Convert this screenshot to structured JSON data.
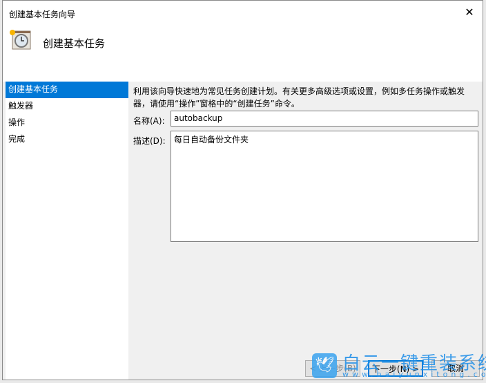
{
  "window": {
    "title": "创建基本任务向导",
    "heading": "创建基本任务"
  },
  "nav": [
    "创建基本任务",
    "触发器",
    "操作",
    "完成"
  ],
  "intro": "利用该向导快速地为常见任务创建计划。有关更多高级选项或设置，例如多任务操作或触发器，请使用“操作”窗格中的“创建任务”命令。",
  "form": {
    "name_label": "名称(A):",
    "name_value": "autobackup",
    "desc_label": "描述(D):",
    "desc_value": "每日自动备份文件夹"
  },
  "buttons": {
    "back": "< 上一步(B)",
    "next": "下一步(N) >",
    "cancel": "取消"
  },
  "watermark": {
    "text": "白云一键重装系统",
    "url": "www.baiyunxitong.com"
  },
  "colors": {
    "accent": "#0078d7"
  }
}
